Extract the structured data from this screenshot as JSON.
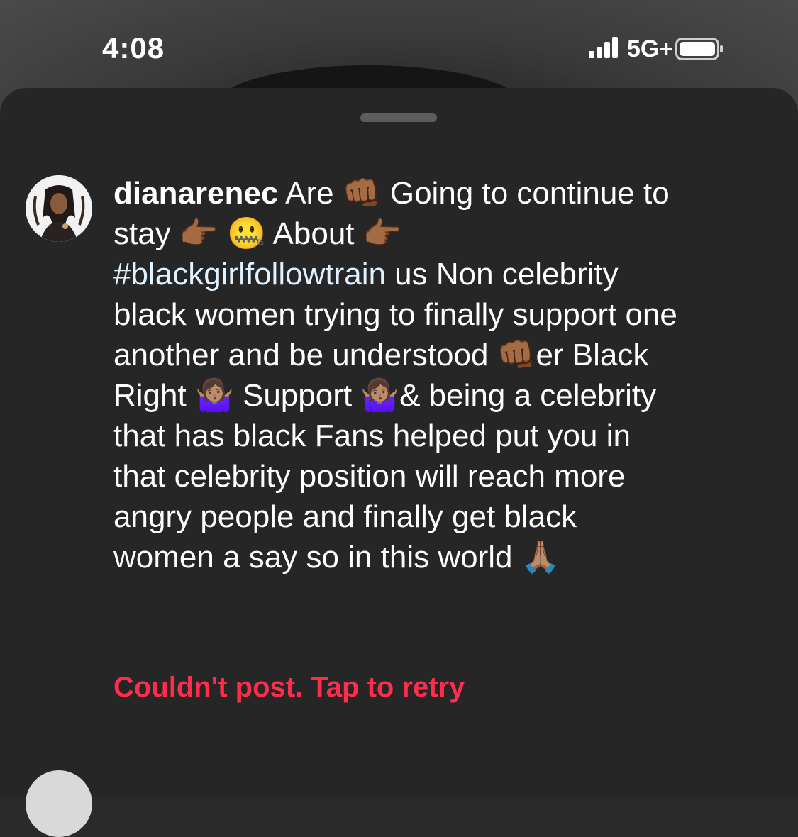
{
  "status_bar": {
    "time": "4:08",
    "network": "5G+",
    "signal_icon": "cellular-signal-icon",
    "battery_icon": "battery-icon"
  },
  "comment": {
    "username": "dianarenec",
    "avatar_icon": "profile-avatar",
    "seg1": " Are ",
    "emoji_fist": "👊🏾",
    "seg2": " Going to continue to stay ",
    "emoji_point1": "👉🏾",
    "seg3": " ",
    "emoji_zipper": "🤐",
    "seg4": "  About ",
    "emoji_point2": "👉🏾",
    "seg5": " ",
    "hashtag": "#blackgirlfollowtrain",
    "seg6": " us Non celebrity black women trying to finally support one another and be understood ",
    "emoji_fist2": "👊🏾",
    "seg7": "er Black Right ",
    "emoji_shrug1": "🤷🏽‍♀️",
    "seg8": " Support  ",
    "emoji_shrug2": "🤷🏽‍♀️",
    "seg9": "& being a celebrity that has black Fans helped put you in that celebrity position will reach more angry people and finally get black women a say so in this world ",
    "emoji_pray": "🙏🏽"
  },
  "error_message": "Couldn't post. Tap to retry",
  "next_comment": {
    "partial_text": ""
  },
  "colors": {
    "sheet_bg": "#262626",
    "error_red": "#ff2d4b",
    "hashtag": "#e0f1ff"
  }
}
